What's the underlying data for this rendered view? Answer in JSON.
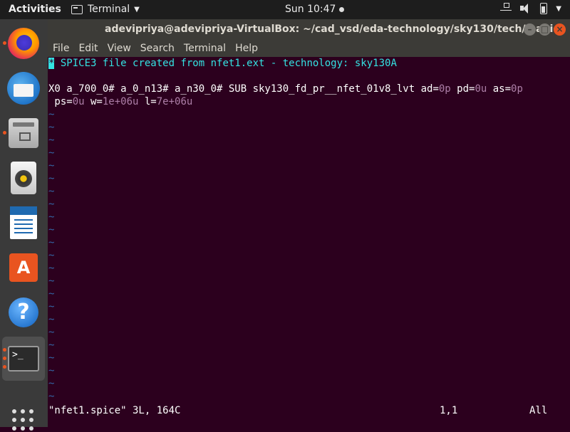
{
  "topbar": {
    "activities": "Activities",
    "app_name": "Terminal",
    "clock": "Sun 10:47"
  },
  "window": {
    "title": "adevipriya@adevipriya-VirtualBox: ~/cad_vsd/eda-technology/sky130/tech/magic",
    "menu": [
      "File",
      "Edit",
      "View",
      "Search",
      "Terminal",
      "Help"
    ]
  },
  "dock": {
    "icons": [
      "firefox-icon",
      "thunderbird-icon",
      "files-icon",
      "rhythmbox-icon",
      "writer-icon",
      "software-icon",
      "help-icon",
      "terminal-icon",
      "show-apps-icon"
    ],
    "terminal_glyph": ">_"
  },
  "editor": {
    "line1_cursor": "*",
    "line1_text": " SPICE3 file created from nfet1.ext - technology: sky130A",
    "line3": {
      "prefix": "X0 a_700_0# a_0_n13# a_n30_0# SUB sky130_fd_pr__nfet_01v8_lvt ad=",
      "ad": "0p",
      "pd_label": " pd=",
      "pd": "0u",
      "as_label": " as=",
      "as": "0p"
    },
    "line4": {
      "ps_label": " ps=",
      "ps": "0u",
      "w_label": " w=",
      "w": "1e+06u",
      "l_label": " l=",
      "l": "7e+06u"
    },
    "tilde": "~",
    "tilde_count": 23,
    "status_file": "\"nfet1.spice\" 3L, 164C",
    "status_pos": "1,1",
    "status_scroll": "All"
  },
  "colors": {
    "terminal_bg": "#2c001e",
    "cyan": "#34e2e2",
    "purple": "#ad7fa8",
    "tilde_blue": "#3465a4",
    "accent_orange": "#e95420"
  }
}
